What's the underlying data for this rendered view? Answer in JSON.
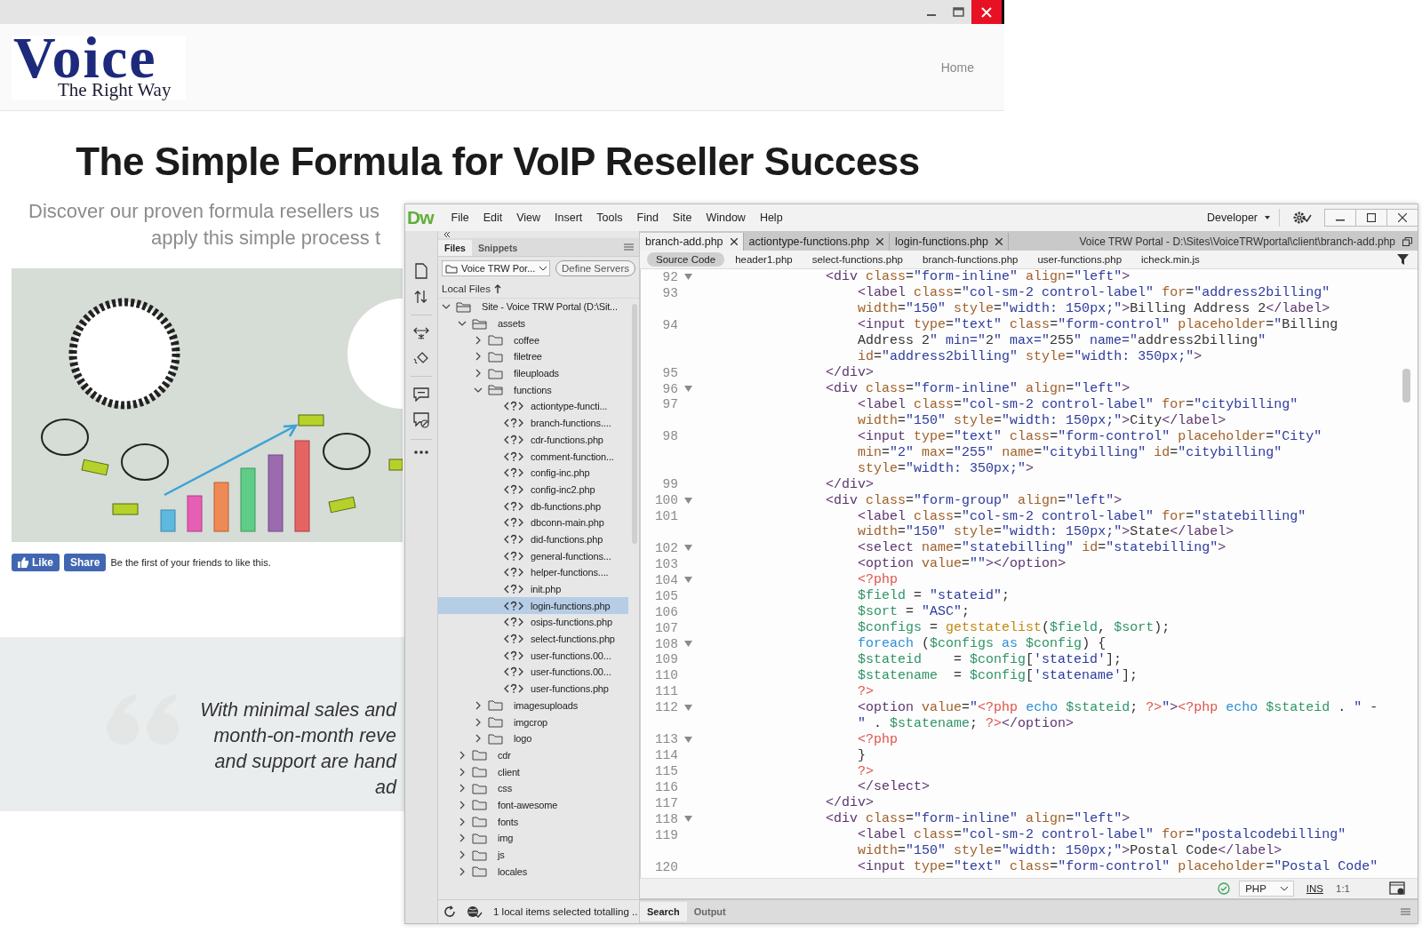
{
  "browser": {
    "logo": {
      "wordmark": "Voice",
      "tagline": "The Right Way"
    },
    "nav_links": [
      "Home"
    ],
    "headline": "The Simple Formula for VoIP Reseller Success",
    "subtitle_lines": [
      "Discover our proven formula resellers us",
      "apply this simple process t"
    ],
    "social": {
      "like": "Like",
      "share": "Share",
      "note": "Be the first of your friends to like this."
    },
    "quote_lines": [
      "With minimal sales and",
      "month-on-month reve",
      "and support are hand",
      "ad"
    ]
  },
  "dreamweaver": {
    "app_logo": "Dw",
    "menu": [
      "File",
      "Edit",
      "View",
      "Insert",
      "Tools",
      "Find",
      "Site",
      "Window",
      "Help"
    ],
    "workspace": "Developer",
    "files_panel": {
      "tabs": [
        {
          "label": "Files",
          "selected": true
        },
        {
          "label": "Snippets",
          "selected": false
        }
      ],
      "site": "Voice TRW Por...",
      "define_servers": "Define Servers",
      "header": "Local Files",
      "tree": [
        {
          "name": "Site - Voice TRW Portal (D:\\Sit...",
          "kind": "site",
          "expanded": true,
          "selected": false,
          "children": [
            {
              "name": "assets",
              "kind": "folder",
              "expanded": true,
              "selected": false,
              "children": [
                {
                  "name": "coffee",
                  "kind": "folder",
                  "expanded": false,
                  "selected": false
                },
                {
                  "name": "filetree",
                  "kind": "folder",
                  "expanded": false,
                  "selected": false
                },
                {
                  "name": "fileuploads",
                  "kind": "folder",
                  "expanded": false,
                  "selected": false
                },
                {
                  "name": "functions",
                  "kind": "folder",
                  "expanded": true,
                  "selected": false,
                  "children": [
                    {
                      "name": "actiontype-functi...",
                      "kind": "file",
                      "selected": false
                    },
                    {
                      "name": "branch-functions....",
                      "kind": "file",
                      "selected": false
                    },
                    {
                      "name": "cdr-functions.php",
                      "kind": "file",
                      "selected": false
                    },
                    {
                      "name": "comment-function...",
                      "kind": "file",
                      "selected": false
                    },
                    {
                      "name": "config-inc.php",
                      "kind": "file",
                      "selected": false
                    },
                    {
                      "name": "config-inc2.php",
                      "kind": "file",
                      "selected": false
                    },
                    {
                      "name": "db-functions.php",
                      "kind": "file",
                      "selected": false
                    },
                    {
                      "name": "dbconn-main.php",
                      "kind": "file",
                      "selected": false
                    },
                    {
                      "name": "did-functions.php",
                      "kind": "file",
                      "selected": false
                    },
                    {
                      "name": "general-functions...",
                      "kind": "file",
                      "selected": false
                    },
                    {
                      "name": "helper-functions....",
                      "kind": "file",
                      "selected": false
                    },
                    {
                      "name": "init.php",
                      "kind": "file",
                      "selected": false
                    },
                    {
                      "name": "login-functions.php",
                      "kind": "file",
                      "selected": true
                    },
                    {
                      "name": "osips-functions.php",
                      "kind": "file",
                      "selected": false
                    },
                    {
                      "name": "select-functions.php",
                      "kind": "file",
                      "selected": false
                    },
                    {
                      "name": "user-functions.00...",
                      "kind": "file",
                      "selected": false
                    },
                    {
                      "name": "user-functions.00...",
                      "kind": "file",
                      "selected": false
                    },
                    {
                      "name": "user-functions.php",
                      "kind": "file",
                      "selected": false
                    }
                  ]
                },
                {
                  "name": "imagesuploads",
                  "kind": "folder",
                  "expanded": false,
                  "selected": false
                },
                {
                  "name": "imgcrop",
                  "kind": "folder",
                  "expanded": false,
                  "selected": false
                },
                {
                  "name": "logo",
                  "kind": "folder",
                  "expanded": false,
                  "selected": false
                }
              ]
            },
            {
              "name": "cdr",
              "kind": "folder",
              "expanded": false,
              "selected": false
            },
            {
              "name": "client",
              "kind": "folder",
              "expanded": false,
              "selected": false
            },
            {
              "name": "css",
              "kind": "folder",
              "expanded": false,
              "selected": false
            },
            {
              "name": "font-awesome",
              "kind": "folder",
              "expanded": false,
              "selected": false
            },
            {
              "name": "fonts",
              "kind": "folder",
              "expanded": false,
              "selected": false
            },
            {
              "name": "img",
              "kind": "folder",
              "expanded": false,
              "selected": false
            },
            {
              "name": "js",
              "kind": "folder",
              "expanded": false,
              "selected": false
            },
            {
              "name": "locales",
              "kind": "folder",
              "expanded": false,
              "selected": false
            }
          ]
        }
      ],
      "status": "1 local items selected totalling .."
    },
    "document_tabs": [
      {
        "label": "branch-add.php",
        "selected": true
      },
      {
        "label": "actiontype-functions.php",
        "selected": false
      },
      {
        "label": "login-functions.php",
        "selected": false
      }
    ],
    "document_path": "Voice TRW Portal - D:\\Sites\\VoiceTRWportal\\client\\branch-add.php",
    "related_files": [
      {
        "label": "Source Code",
        "selected": true
      },
      {
        "label": "header1.php",
        "selected": false
      },
      {
        "label": "select-functions.php",
        "selected": false
      },
      {
        "label": "branch-functions.php",
        "selected": false
      },
      {
        "label": "user-functions.php",
        "selected": false
      },
      {
        "label": "icheck.min.js",
        "selected": false
      }
    ],
    "code_lines": [
      {
        "number": "92",
        "foldable": true,
        "rows": [
          "<div class=\"form-inline\" align=\"left\">"
        ]
      },
      {
        "number": "93",
        "foldable": false,
        "rows": [
          "    <label class=\"col-sm-2 control-label\" for=\"address2billing\"",
          "    width=\"150\" style=\"width: 150px;\">Billing Address 2</label>"
        ]
      },
      {
        "number": "94",
        "foldable": false,
        "rows": [
          "    <input type=\"text\" class=\"form-control\" placeholder=\"Billing",
          "    Address 2\" min=\"2\" max=\"255\" name=\"address2billing\"",
          "    id=\"address2billing\" style=\"width: 350px;\">"
        ]
      },
      {
        "number": "95",
        "foldable": false,
        "rows": [
          "</div>"
        ]
      },
      {
        "number": "96",
        "foldable": true,
        "rows": [
          "<div class=\"form-inline\" align=\"left\">"
        ]
      },
      {
        "number": "97",
        "foldable": false,
        "rows": [
          "    <label class=\"col-sm-2 control-label\" for=\"citybilling\"",
          "    width=\"150\" style=\"width: 150px;\">City</label>"
        ]
      },
      {
        "number": "98",
        "foldable": false,
        "rows": [
          "    <input type=\"text\" class=\"form-control\" placeholder=\"City\"",
          "    min=\"2\" max=\"255\" name=\"citybilling\" id=\"citybilling\"",
          "    style=\"width: 350px;\">"
        ]
      },
      {
        "number": "99",
        "foldable": false,
        "rows": [
          "</div>"
        ]
      },
      {
        "number": "100",
        "foldable": true,
        "rows": [
          "<div class=\"form-group\" align=\"left\">"
        ]
      },
      {
        "number": "101",
        "foldable": false,
        "rows": [
          "    <label class=\"col-sm-2 control-label\" for=\"statebilling\"",
          "    width=\"150\" style=\"width: 150px;\">State</label>"
        ]
      },
      {
        "number": "102",
        "foldable": true,
        "rows": [
          "    <select name=\"statebilling\" id=\"statebilling\">"
        ]
      },
      {
        "number": "103",
        "foldable": false,
        "rows": [
          "    <option value=\"\"></option>"
        ]
      },
      {
        "number": "104",
        "foldable": true,
        "rows": [
          "    <?php"
        ]
      },
      {
        "number": "105",
        "foldable": false,
        "rows": [
          "    $field = \"stateid\";"
        ]
      },
      {
        "number": "106",
        "foldable": false,
        "rows": [
          "    $sort = \"ASC\";"
        ]
      },
      {
        "number": "107",
        "foldable": false,
        "rows": [
          "    $configs = getstatelist($field, $sort);"
        ]
      },
      {
        "number": "108",
        "foldable": true,
        "rows": [
          "    foreach ($configs as $config) {"
        ]
      },
      {
        "number": "109",
        "foldable": false,
        "rows": [
          "    $stateid    = $config['stateid'];"
        ]
      },
      {
        "number": "110",
        "foldable": false,
        "rows": [
          "    $statename  = $config['statename'];"
        ]
      },
      {
        "number": "111",
        "foldable": false,
        "rows": [
          "    ?>"
        ]
      },
      {
        "number": "112",
        "foldable": true,
        "rows": [
          "    <option value=\"<?php echo $stateid; ?>\"><?php echo $stateid . \" -",
          "    \" . $statename; ?></option>"
        ]
      },
      {
        "number": "113",
        "foldable": true,
        "rows": [
          "    <?php"
        ]
      },
      {
        "number": "114",
        "foldable": false,
        "rows": [
          "    }"
        ]
      },
      {
        "number": "115",
        "foldable": false,
        "rows": [
          "    ?>"
        ]
      },
      {
        "number": "116",
        "foldable": false,
        "rows": [
          "    </select>"
        ]
      },
      {
        "number": "117",
        "foldable": false,
        "rows": [
          "</div>"
        ]
      },
      {
        "number": "118",
        "foldable": true,
        "rows": [
          "<div class=\"form-inline\" align=\"left\">"
        ]
      },
      {
        "number": "119",
        "foldable": false,
        "rows": [
          "    <label class=\"col-sm-2 control-label\" for=\"postalcodebilling\"",
          "    width=\"150\" style=\"width: 150px;\">Postal Code</label>"
        ]
      },
      {
        "number": "120",
        "foldable": false,
        "rows": [
          "    <input type=\"text\" class=\"form-control\" placeholder=\"Postal Code\""
        ]
      }
    ],
    "status_bar": {
      "language": "PHP",
      "mode": "INS",
      "position": "1:1"
    },
    "bottom_tabs": [
      {
        "label": "Search",
        "selected": true
      },
      {
        "label": "Output",
        "selected": false
      }
    ]
  }
}
